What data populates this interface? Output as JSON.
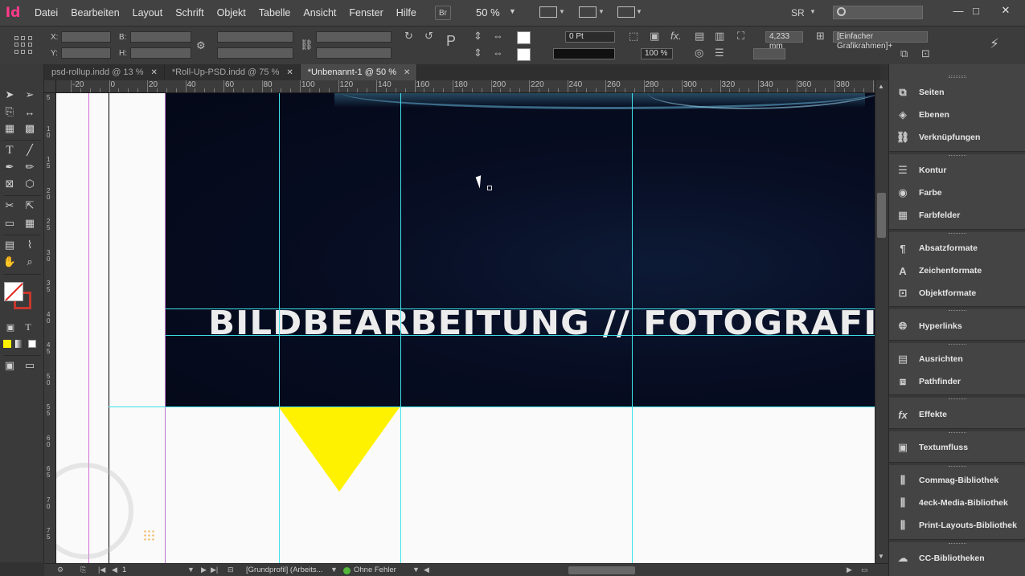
{
  "app": {
    "logo": "Id",
    "menu": [
      "Datei",
      "Bearbeiten",
      "Layout",
      "Schrift",
      "Objekt",
      "Tabelle",
      "Ansicht",
      "Fenster",
      "Hilfe"
    ],
    "bridge_button": "Br",
    "zoom": "50 %",
    "user_initials": "SR",
    "search_placeholder": ""
  },
  "control_panel": {
    "x_label": "X:",
    "y_label": "Y:",
    "w_label": "B:",
    "h_label": "H:",
    "stroke_weight": "0 Pt",
    "opacity": "100 %",
    "size_value": "4,233 mm",
    "frame_style": "[Einfacher Grafikrahmen]+"
  },
  "tabs": [
    {
      "label": "psd-rollup.indd @ 13 %",
      "active": false
    },
    {
      "label": "*Roll-Up-PSD.indd @ 75 %",
      "active": false
    },
    {
      "label": "*Unbenannt-1 @ 50 %",
      "active": true
    }
  ],
  "ruler_top": [
    "-20",
    "0",
    "20",
    "40",
    "60",
    "80",
    "100",
    "120",
    "140",
    "160",
    "180",
    "200",
    "220",
    "240",
    "260",
    "280",
    "300",
    "320",
    "340",
    "360",
    "380",
    "40"
  ],
  "ruler_left": [
    "5",
    "1 0",
    "1 5",
    "2 0",
    "2 5",
    "3 0",
    "3 5",
    "4 0",
    "4 5",
    "5 0",
    "5 5",
    "6 0",
    "6 5",
    "7 0",
    "7 5"
  ],
  "document": {
    "headline": "BILDBEARBEITUNG // FOTOGRAFIE /",
    "triangle_color": "#fff200",
    "guide_color": "#3fe1e8"
  },
  "status": {
    "page_number": "1",
    "profile": "[Grundprofil] (Arbeits...",
    "preflight": "Ohne Fehler"
  },
  "panels": [
    {
      "icon": "pages-icon",
      "label": "Seiten"
    },
    {
      "icon": "layers-icon",
      "label": "Ebenen"
    },
    {
      "icon": "links-icon",
      "label": "Verknüpfungen"
    },
    {
      "icon": "stroke-icon",
      "label": "Kontur"
    },
    {
      "icon": "color-icon",
      "label": "Farbe"
    },
    {
      "icon": "swatches-icon",
      "label": "Farbfelder"
    },
    {
      "icon": "paragraph-styles-icon",
      "label": "Absatzformate"
    },
    {
      "icon": "character-styles-icon",
      "label": "Zeichenformate"
    },
    {
      "icon": "object-styles-icon",
      "label": "Objektformate"
    },
    {
      "icon": "hyperlinks-icon",
      "label": "Hyperlinks"
    },
    {
      "icon": "align-icon",
      "label": "Ausrichten"
    },
    {
      "icon": "pathfinder-icon",
      "label": "Pathfinder"
    },
    {
      "icon": "effects-icon",
      "label": "Effekte"
    },
    {
      "icon": "text-wrap-icon",
      "label": "Textumfluss"
    },
    {
      "icon": "library-icon",
      "label": "Commag-Bibliothek"
    },
    {
      "icon": "library-icon",
      "label": "4eck-Media-Bibliothek"
    },
    {
      "icon": "library-icon",
      "label": "Print-Layouts-Bibliothek"
    },
    {
      "icon": "cc-libraries-icon",
      "label": "CC-Bibliotheken"
    }
  ]
}
